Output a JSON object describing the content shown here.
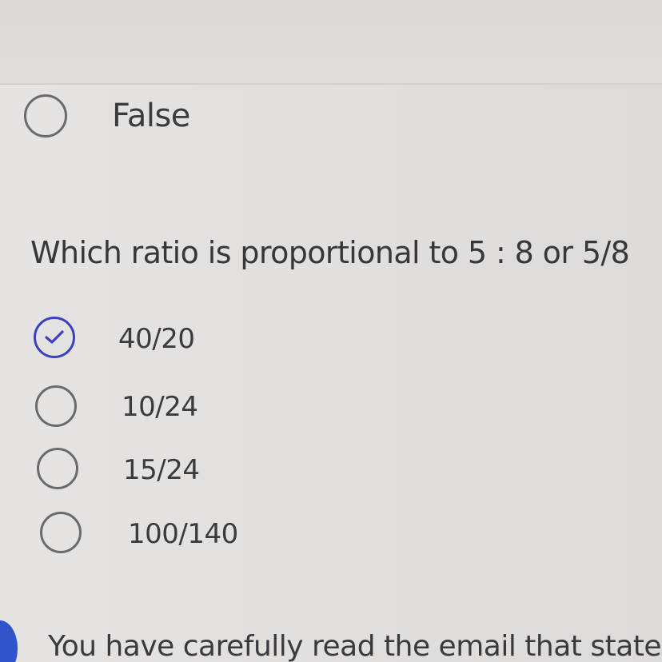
{
  "previous_question": {
    "option_label": "False"
  },
  "question": {
    "text": "Which ratio is proportional to 5 : 8  or 5/8",
    "options": [
      {
        "label": "40/20",
        "selected": true
      },
      {
        "label": "10/24",
        "selected": false
      },
      {
        "label": "15/24",
        "selected": false
      },
      {
        "label": "100/140",
        "selected": false
      }
    ]
  },
  "next_question": {
    "text": "You have carefully read the email that states"
  },
  "colors": {
    "selected_accent": "#3a3fc4",
    "next_marker": "#2f55c8"
  }
}
